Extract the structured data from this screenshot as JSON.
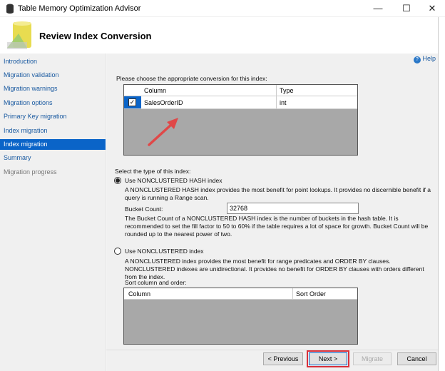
{
  "window": {
    "title": "Table Memory Optimization Advisor",
    "minimize": "—",
    "maximize": "☐",
    "close": "✕"
  },
  "header": {
    "title": "Review Index Conversion"
  },
  "nav": {
    "items": [
      {
        "label": "Introduction"
      },
      {
        "label": "Migration validation"
      },
      {
        "label": "Migration warnings"
      },
      {
        "label": "Migration options"
      },
      {
        "label": "Primary Key migration"
      },
      {
        "label": "Index migration"
      },
      {
        "label": "Index migration"
      },
      {
        "label": "Summary"
      },
      {
        "label": "Migration progress"
      }
    ]
  },
  "help": "Help",
  "main": {
    "choose_label": "Please choose the appropriate conversion for this index:",
    "grid": {
      "columns": [
        "Column",
        "Type"
      ],
      "rows": [
        {
          "checked": true,
          "column": "SalesOrderID",
          "type": "int"
        }
      ]
    },
    "type_label": "Select the type of this index:",
    "hash_option": {
      "label": "Use NONCLUSTERED HASH index",
      "selected": true,
      "description": "A NONCLUSTERED HASH index provides the most benefit for point lookups. It provides no discernible benefit if a query is running a Range scan.",
      "bucket_label": "Bucket Count:",
      "bucket_value": "32768",
      "bucket_description": "The Bucket Count of a NONCLUSTERED HASH index is the number of buckets in the hash table. It is recommended to set the fill factor to 50 to 60% if the table requires a lot of space for growth. Bucket Count will be rounded up to the nearest power of two."
    },
    "nc_option": {
      "label": "Use NONCLUSTERED index",
      "selected": false,
      "description": "A NONCLUSTERED index provides the most benefit for range predicates and ORDER BY clauses. NONCLUSTERED indexes are unidirectional. It provides no benefit for ORDER BY clauses with orders different from the index.",
      "sort_label": "Sort column and order:",
      "sort_columns": [
        "Column",
        "Sort Order"
      ]
    }
  },
  "footer": {
    "previous": "< Previous",
    "next": "Next >",
    "migrate": "Migrate",
    "cancel": "Cancel"
  },
  "colors": {
    "accent": "#0a64c8",
    "highlight": "#d9303a",
    "arrow": "#e04848"
  }
}
